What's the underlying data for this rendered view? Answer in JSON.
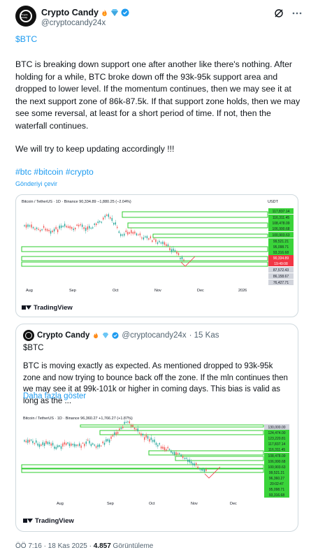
{
  "author": {
    "name": "Crypto Candy",
    "handle": "@cryptocandy24x",
    "avatar_text": "Crypto Candy"
  },
  "post": {
    "cashtag": "$BTC",
    "paragraph1": "BTC is breaking down support one after another like there's nothing. After holding for a while, BTC broke down off the 93k-95k support area and dropped to lower level. If the momentum continues, then we may see it at the next support zone of 86k-87.5k. If that support zone holds, then we may see some reversal, at least for a short period of time. If not, then the waterfall continues.",
    "paragraph2": "We will try to keep updating accordingly !!!",
    "hashtags": "#btc #bitcoin #crypto",
    "translate": "Gönderiyi çevir"
  },
  "chart1": {
    "header": "Bitcoin / TetherUS · 1D · Binance  90,334.89  −1,880.25 (−2.04%)",
    "currency": "USDT",
    "price_labels": [
      "117,837.14",
      "116,311.45",
      "108,478.09",
      "106,990.68",
      "100,903.63",
      "99,521.21",
      "95,098.71",
      "93,316.68",
      "90,334.89",
      "19:49:08",
      "87,572.43",
      "86,158.67",
      "76,427.71"
    ],
    "x_labels": [
      "Aug",
      "Sep",
      "Oct",
      "Nov",
      "Dec",
      "2026"
    ],
    "brand": "TradingView"
  },
  "quote": {
    "name": "Crypto Candy",
    "handle": "@cryptocandy24x",
    "time": "· 15 Kas",
    "cashtag": "$BTC",
    "text": "BTC is moving exactly as expected. As mentioned dropped to 93k-95k zone and now trying to bounce back off the zone. If the mln continues then we may see it at 99k-101k or higher in coming days. This bias is valid as long as the ...",
    "show_more": "Daha fazla göster"
  },
  "chart2": {
    "header": "Bitcoin / TetherUS · 1D · Binance  96,360.27  +1,766.27 (+1.87%)",
    "price_labels": [
      "130,000.00",
      "124,474.00",
      "123,220.81",
      "117,837.14",
      "116,311.45",
      "108,478.09",
      "106,990.68",
      "100,903.63",
      "99,521.21",
      "96,360.27",
      "20:02:47",
      "95,098.71",
      "93,316.68"
    ],
    "x_labels": [
      "Aug",
      "Sep",
      "Oct",
      "Nov",
      "Dec"
    ],
    "brand": "TradingView"
  },
  "footer": {
    "time": "ÖÖ 7:16 · 18 Kas 2025 · ",
    "views": "4.857",
    "views_label": " Görüntüleme"
  },
  "colors": {
    "accent": "#1d9bf0",
    "zone_green": "#2ecc2e",
    "candle_up": "#26a69a",
    "candle_down": "#ef5350",
    "price_red": "#f23645"
  }
}
